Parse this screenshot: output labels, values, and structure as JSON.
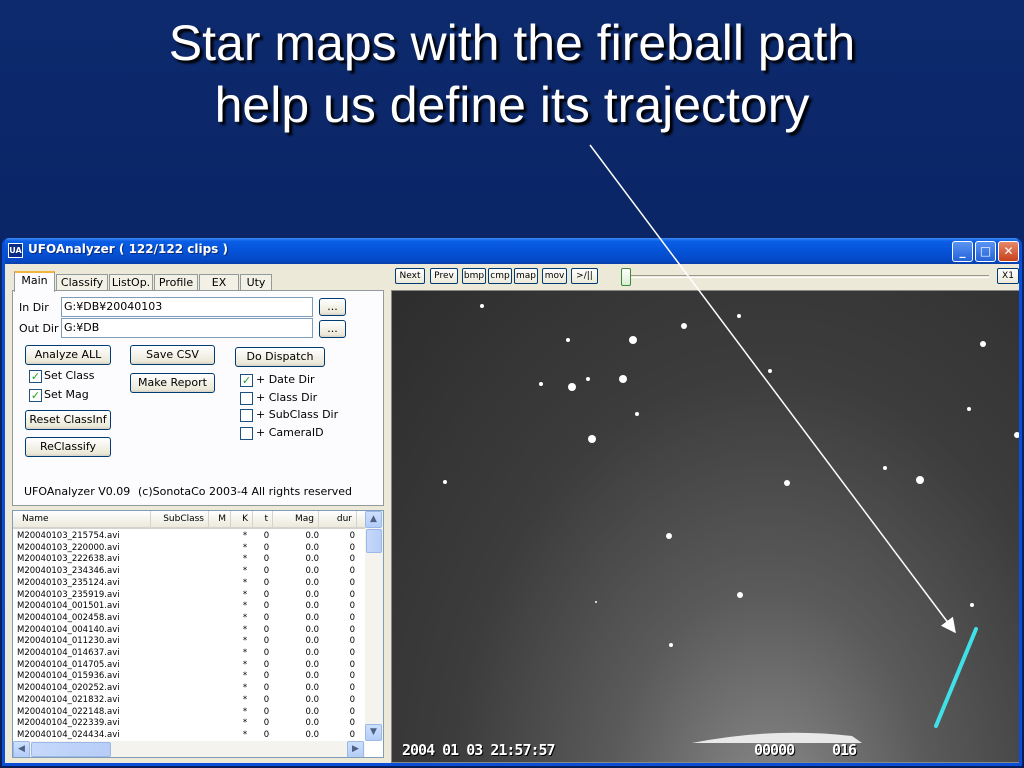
{
  "slide": {
    "title_line1": "Star maps with the fireball path",
    "title_line2": "help us define its trajectory"
  },
  "window": {
    "app_icon": "UA",
    "title": "UFOAnalyzer ( 122/122 clips )",
    "minimize": "_",
    "maximize": "□",
    "close": "✕"
  },
  "tabs": [
    "Main",
    "Classify",
    "ListOp.",
    "Profile",
    "EX",
    "Uty"
  ],
  "main": {
    "in_dir_label": "In Dir",
    "in_dir_value": "G:¥DB¥20040103",
    "out_dir_label": "Out Dir",
    "out_dir_value": "G:¥DB",
    "browse_label": "...",
    "analyze_all": "Analyze ALL",
    "save_csv": "Save CSV",
    "do_dispatch": "Do Dispatch",
    "make_report": "Make Report",
    "reset_classinf": "Reset ClassInf",
    "reclassify": "ReClassify",
    "checks_left": [
      {
        "label": "Set Class",
        "checked": true
      },
      {
        "label": "Set Mag",
        "checked": true
      }
    ],
    "checks_right": [
      {
        "label": "+ Date Dir",
        "checked": true
      },
      {
        "label": "+ Class Dir",
        "checked": false
      },
      {
        "label": "+ SubClass Dir",
        "checked": false
      },
      {
        "label": "+ CameraID",
        "checked": false
      }
    ],
    "check_mark": "✓",
    "version": "UFOAnalyzer V0.09",
    "copyright": "(c)SonotaCo 2003-4 All rights reserved"
  },
  "list": {
    "columns": [
      "Name",
      "SubClass",
      "M",
      "K",
      "t",
      "Mag",
      "dur"
    ],
    "rows": [
      [
        "M20040103_215754.avi",
        "",
        "",
        "*",
        "0",
        "0.0",
        "0"
      ],
      [
        "M20040103_220000.avi",
        "",
        "",
        "*",
        "0",
        "0.0",
        "0"
      ],
      [
        "M20040103_222638.avi",
        "",
        "",
        "*",
        "0",
        "0.0",
        "0"
      ],
      [
        "M20040103_234346.avi",
        "",
        "",
        "*",
        "0",
        "0.0",
        "0"
      ],
      [
        "M20040103_235124.avi",
        "",
        "",
        "*",
        "0",
        "0.0",
        "0"
      ],
      [
        "M20040103_235919.avi",
        "",
        "",
        "*",
        "0",
        "0.0",
        "0"
      ],
      [
        "M20040104_001501.avi",
        "",
        "",
        "*",
        "0",
        "0.0",
        "0"
      ],
      [
        "M20040104_002458.avi",
        "",
        "",
        "*",
        "0",
        "0.0",
        "0"
      ],
      [
        "M20040104_004140.avi",
        "",
        "",
        "*",
        "0",
        "0.0",
        "0"
      ],
      [
        "M20040104_011230.avi",
        "",
        "",
        "*",
        "0",
        "0.0",
        "0"
      ],
      [
        "M20040104_014637.avi",
        "",
        "",
        "*",
        "0",
        "0.0",
        "0"
      ],
      [
        "M20040104_014705.avi",
        "",
        "",
        "*",
        "0",
        "0.0",
        "0"
      ],
      [
        "M20040104_015936.avi",
        "",
        "",
        "*",
        "0",
        "0.0",
        "0"
      ],
      [
        "M20040104_020252.avi",
        "",
        "",
        "*",
        "0",
        "0.0",
        "0"
      ],
      [
        "M20040104_021832.avi",
        "",
        "",
        "*",
        "0",
        "0.0",
        "0"
      ],
      [
        "M20040104_022148.avi",
        "",
        "",
        "*",
        "0",
        "0.0",
        "0"
      ],
      [
        "M20040104_022339.avi",
        "",
        "",
        "*",
        "0",
        "0.0",
        "0"
      ],
      [
        "M20040104_024434.avi",
        "",
        "",
        "*",
        "0",
        "0.0",
        "0"
      ]
    ],
    "scroll_up": "▲",
    "scroll_down": "▼",
    "scroll_left": "◀",
    "scroll_right": "▶"
  },
  "viewer": {
    "buttons": [
      "Next",
      "Prev",
      "bmp",
      "cmp",
      "map",
      "mov",
      ">/||"
    ],
    "zoom": "X1",
    "timestamp": "2004 01 03  21:57:57",
    "frame": "00000",
    "field": "016",
    "meteor_color": "#3fe0e8"
  }
}
